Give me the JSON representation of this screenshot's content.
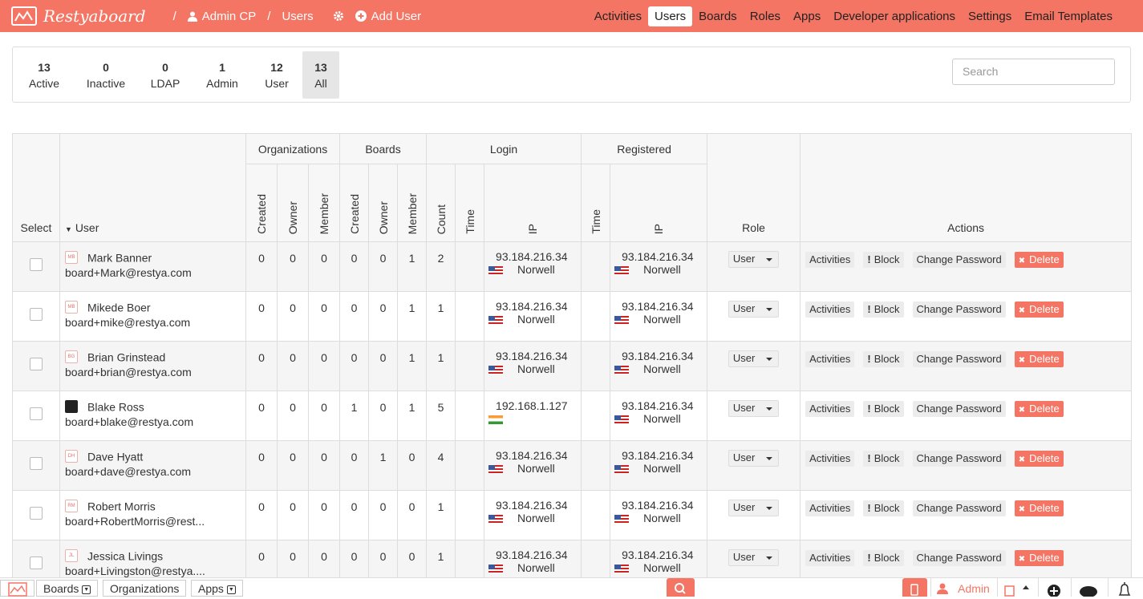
{
  "app": {
    "brand": "Restyaboard",
    "accent": "#f47564"
  },
  "breadcrumb": {
    "admin_cp": "Admin CP",
    "sep": "/",
    "users": "Users",
    "add_user": "Add User"
  },
  "topnav": [
    "Activities",
    "Users",
    "Boards",
    "Roles",
    "Apps",
    "Developer applications",
    "Settings",
    "Email Templates"
  ],
  "filters": [
    {
      "num": "13",
      "label": "Active"
    },
    {
      "num": "0",
      "label": "Inactive"
    },
    {
      "num": "0",
      "label": "LDAP"
    },
    {
      "num": "1",
      "label": "Admin"
    },
    {
      "num": "12",
      "label": "User"
    },
    {
      "num": "13",
      "label": "All"
    }
  ],
  "search": {
    "placeholder": "Search"
  },
  "table": {
    "headers": {
      "select": "Select",
      "user": "User",
      "organizations": "Organizations",
      "boards": "Boards",
      "login": "Login",
      "registered": "Registered",
      "role": "Role",
      "actions": "Actions",
      "created": "Created",
      "owner": "Owner",
      "member": "Member",
      "count": "Count",
      "time": "Time",
      "ip": "IP"
    },
    "action_labels": {
      "activities": "Activities",
      "block": "Block",
      "change_password": "Change Password",
      "delete": "Delete"
    },
    "rows": [
      {
        "initials": "MB",
        "name": "Mark Banner",
        "email": "board+Mark@restya.com",
        "org_created": "0",
        "org_owner": "0",
        "org_member": "0",
        "b_created": "0",
        "b_owner": "0",
        "b_member": "1",
        "login_count": "2",
        "login_ip": "93.184.216.34",
        "login_flag": "us",
        "login_city": "Norwell",
        "reg_ip": "93.184.216.34",
        "reg_city": "Norwell",
        "role": "User"
      },
      {
        "initials": "MB",
        "name": "Mikede Boer",
        "email": "board+mike@restya.com",
        "org_created": "0",
        "org_owner": "0",
        "org_member": "0",
        "b_created": "0",
        "b_owner": "0",
        "b_member": "1",
        "login_count": "1",
        "login_ip": "93.184.216.34",
        "login_flag": "us",
        "login_city": "Norwell",
        "reg_ip": "93.184.216.34",
        "reg_city": "Norwell",
        "role": "User"
      },
      {
        "initials": "BG",
        "name": "Brian Grinstead",
        "email": "board+brian@restya.com",
        "org_created": "0",
        "org_owner": "0",
        "org_member": "0",
        "b_created": "0",
        "b_owner": "0",
        "b_member": "1",
        "login_count": "1",
        "login_ip": "93.184.216.34",
        "login_flag": "us",
        "login_city": "Norwell",
        "reg_ip": "93.184.216.34",
        "reg_city": "Norwell",
        "role": "User"
      },
      {
        "initials": "",
        "photo": true,
        "name": "Blake Ross",
        "email": "board+blake@restya.com",
        "org_created": "0",
        "org_owner": "0",
        "org_member": "0",
        "b_created": "1",
        "b_owner": "0",
        "b_member": "1",
        "login_count": "5",
        "login_ip": "192.168.1.127",
        "login_flag": "in",
        "login_city": "",
        "reg_ip": "93.184.216.34",
        "reg_city": "Norwell",
        "role": "User"
      },
      {
        "initials": "DH",
        "name": "Dave Hyatt",
        "email": "board+dave@restya.com",
        "org_created": "0",
        "org_owner": "0",
        "org_member": "0",
        "b_created": "0",
        "b_owner": "1",
        "b_member": "0",
        "login_count": "4",
        "login_ip": "93.184.216.34",
        "login_flag": "us",
        "login_city": "Norwell",
        "reg_ip": "93.184.216.34",
        "reg_city": "Norwell",
        "role": "User"
      },
      {
        "initials": "RM",
        "name": "Robert Morris",
        "email": "board+RobertMorris@rest...",
        "org_created": "0",
        "org_owner": "0",
        "org_member": "0",
        "b_created": "0",
        "b_owner": "0",
        "b_member": "0",
        "login_count": "1",
        "login_ip": "93.184.216.34",
        "login_flag": "us",
        "login_city": "Norwell",
        "reg_ip": "93.184.216.34",
        "reg_city": "Norwell",
        "role": "User"
      },
      {
        "initials": "JL",
        "name": "Jessica Livings",
        "email": "board+Livingston@restya....",
        "org_created": "0",
        "org_owner": "0",
        "org_member": "0",
        "b_created": "0",
        "b_owner": "0",
        "b_member": "0",
        "login_count": "1",
        "login_ip": "93.184.216.34",
        "login_flag": "us",
        "login_city": "Norwell",
        "reg_ip": "93.184.216.34",
        "reg_city": "Norwell",
        "role": "User"
      }
    ]
  },
  "footer": {
    "boards": "Boards",
    "organizations": "Organizations",
    "apps": "Apps",
    "user": "Admin"
  }
}
